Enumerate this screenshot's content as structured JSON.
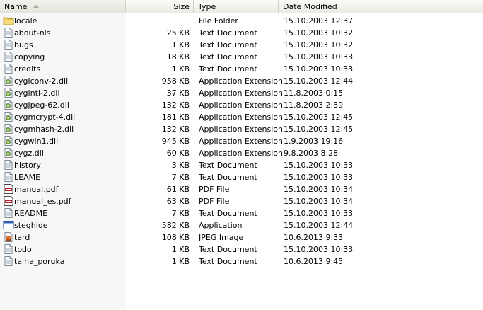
{
  "columns": {
    "name": "Name",
    "size": "Size",
    "type": "Type",
    "date": "Date Modified"
  },
  "files": [
    {
      "name": "locale",
      "size": "",
      "type": "File Folder",
      "date": "15.10.2003 12:37",
      "icon": "folder-icon"
    },
    {
      "name": "about-nls",
      "size": "25 KB",
      "type": "Text Document",
      "date": "15.10.2003 10:32",
      "icon": "text-document-icon"
    },
    {
      "name": "bugs",
      "size": "1 KB",
      "type": "Text Document",
      "date": "15.10.2003 10:32",
      "icon": "text-document-icon"
    },
    {
      "name": "copying",
      "size": "18 KB",
      "type": "Text Document",
      "date": "15.10.2003 10:33",
      "icon": "text-document-icon"
    },
    {
      "name": "credits",
      "size": "1 KB",
      "type": "Text Document",
      "date": "15.10.2003 10:33",
      "icon": "text-document-icon"
    },
    {
      "name": "cygiconv-2.dll",
      "size": "958 KB",
      "type": "Application Extension",
      "date": "15.10.2003 12:44",
      "icon": "dll-icon"
    },
    {
      "name": "cygintl-2.dll",
      "size": "37 KB",
      "type": "Application Extension",
      "date": "11.8.2003 0:15",
      "icon": "dll-icon"
    },
    {
      "name": "cygjpeg-62.dll",
      "size": "132 KB",
      "type": "Application Extension",
      "date": "11.8.2003 2:39",
      "icon": "dll-icon"
    },
    {
      "name": "cygmcrypt-4.dll",
      "size": "181 KB",
      "type": "Application Extension",
      "date": "15.10.2003 12:45",
      "icon": "dll-icon"
    },
    {
      "name": "cygmhash-2.dll",
      "size": "132 KB",
      "type": "Application Extension",
      "date": "15.10.2003 12:45",
      "icon": "dll-icon"
    },
    {
      "name": "cygwin1.dll",
      "size": "945 KB",
      "type": "Application Extension",
      "date": "1.9.2003 19:16",
      "icon": "dll-icon"
    },
    {
      "name": "cygz.dll",
      "size": "60 KB",
      "type": "Application Extension",
      "date": "9.8.2003 8:28",
      "icon": "dll-icon"
    },
    {
      "name": "history",
      "size": "3 KB",
      "type": "Text Document",
      "date": "15.10.2003 10:33",
      "icon": "text-document-icon"
    },
    {
      "name": "LEAME",
      "size": "7 KB",
      "type": "Text Document",
      "date": "15.10.2003 10:33",
      "icon": "text-document-icon"
    },
    {
      "name": "manual.pdf",
      "size": "61 KB",
      "type": "PDF File",
      "date": "15.10.2003 10:34",
      "icon": "pdf-icon"
    },
    {
      "name": "manual_es.pdf",
      "size": "63 KB",
      "type": "PDF File",
      "date": "15.10.2003 10:34",
      "icon": "pdf-icon"
    },
    {
      "name": "README",
      "size": "7 KB",
      "type": "Text Document",
      "date": "15.10.2003 10:33",
      "icon": "text-document-icon"
    },
    {
      "name": "steghide",
      "size": "582 KB",
      "type": "Application",
      "date": "15.10.2003 12:44",
      "icon": "application-icon"
    },
    {
      "name": "tard",
      "size": "108 KB",
      "type": "JPEG Image",
      "date": "10.6.2013 9:33",
      "icon": "jpeg-image-icon"
    },
    {
      "name": "todo",
      "size": "1 KB",
      "type": "Text Document",
      "date": "15.10.2003 10:33",
      "icon": "text-document-icon"
    },
    {
      "name": "tajna_poruka",
      "size": "1 KB",
      "type": "Text Document",
      "date": "10.6.2013 9:45",
      "icon": "text-document-icon"
    }
  ]
}
